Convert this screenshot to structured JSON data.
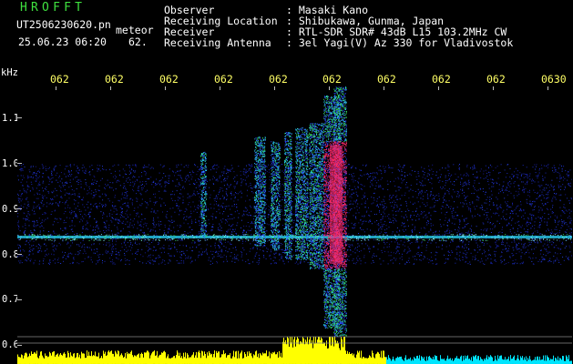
{
  "header": {
    "app_title": "HROFFT",
    "filename": "UT2506230620.pn",
    "mode": "meteor",
    "datetime": "25.06.23 06:20",
    "percent": "62.",
    "info_rows": [
      {
        "label": "Observer",
        "value": ": Masaki Kano"
      },
      {
        "label": "Receiving Location",
        "value": ": Shibukawa, Gunma, Japan"
      },
      {
        "label": "Receiver",
        "value": ": RTL-SDR SDR# 43dB L15 103.2MHz CW"
      },
      {
        "label": "Receiving Antenna",
        "value": ": 3el Yagi(V) Az 330 for Vladivostok"
      }
    ]
  },
  "axis": {
    "y_unit": "kHz",
    "y_ticks": [
      "1.1",
      "1.0",
      "0.9",
      "0.8",
      "0.7",
      "0.6"
    ],
    "time_labels": [
      "062",
      "062",
      "062",
      "062",
      "062",
      "062",
      "062",
      "062",
      "062",
      "0630"
    ]
  },
  "colors": {
    "background": "#000000",
    "title_green": "#3fe13f",
    "time_yellow": "#ffff66",
    "noise_blue": "#1d2fd8",
    "signal_cyan": "#29d8ff",
    "signal_green": "#38e060",
    "signal_red": "#ff2a6a",
    "meter_yellow": "#ffff00",
    "meter_cyan": "#00e5ff"
  }
}
